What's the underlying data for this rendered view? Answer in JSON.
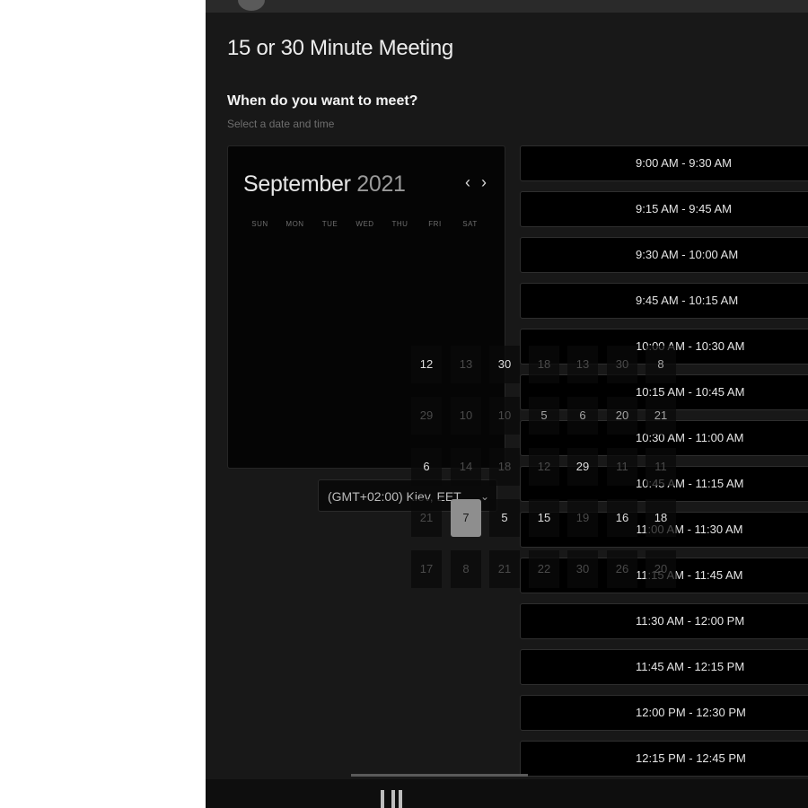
{
  "meeting_title": "15 or 30 Minute Meeting",
  "section_heading": "When do you want to meet?",
  "section_subheading": "Select a date and time",
  "calendar": {
    "month": "September",
    "year": "2021",
    "prev_icon": "‹",
    "next_icon": "›",
    "weekdays": [
      "SUN",
      "MON",
      "TUE",
      "WED",
      "THU",
      "FRI",
      "SAT"
    ]
  },
  "timezone": {
    "value": "(GMT+02:00) Kiev, EET",
    "caret": "⌄"
  },
  "time_slots": [
    "9:00 AM - 9:30 AM",
    "9:15 AM - 9:45 AM",
    "9:30 AM - 10:00 AM",
    "9:45 AM - 10:15 AM",
    "10:00 AM - 10:30 AM",
    "10:15 AM - 10:45 AM",
    "10:30 AM - 11:00 AM",
    "10:45 AM - 11:15 AM",
    "11:00 AM - 11:30 AM",
    "11:15 AM - 11:45 AM",
    "11:30 AM - 12:00 PM",
    "11:45 AM - 12:15 PM",
    "12:00 PM - 12:30 PM",
    "12:15 PM - 12:45 PM"
  ],
  "day_grid": [
    [
      "12",
      "13",
      "30",
      "18",
      "13",
      "30",
      "8"
    ],
    [
      "29",
      "10",
      "10",
      "5",
      "6",
      "20",
      "21"
    ],
    [
      "6",
      "14",
      "18",
      "12",
      "29",
      "11",
      "11"
    ],
    [
      "21",
      "7",
      "5",
      "15",
      "19",
      "16",
      "18"
    ],
    [
      "17",
      "8",
      "21",
      "22",
      "30",
      "26",
      "20"
    ]
  ],
  "day_grid_tone": [
    [
      "bright",
      "dim",
      "bright",
      "dim",
      "dim",
      "dim",
      "mid"
    ],
    [
      "dim",
      "dim",
      "dim",
      "mid",
      "mid",
      "mid",
      "mid"
    ],
    [
      "bright",
      "dim",
      "dim",
      "dim",
      "bright",
      "dim",
      "dim"
    ],
    [
      "dim",
      "selected",
      "bright",
      "bright",
      "dim",
      "bright",
      "bright"
    ],
    [
      "dim",
      "dim",
      "dim",
      "dim",
      "dim",
      "dim",
      "dim"
    ]
  ],
  "selected_day": "7",
  "colors": {
    "app_background": "#181818",
    "panel_background": "#050505",
    "slot_background": "#000000",
    "selected_day": "#8e8e8e"
  }
}
